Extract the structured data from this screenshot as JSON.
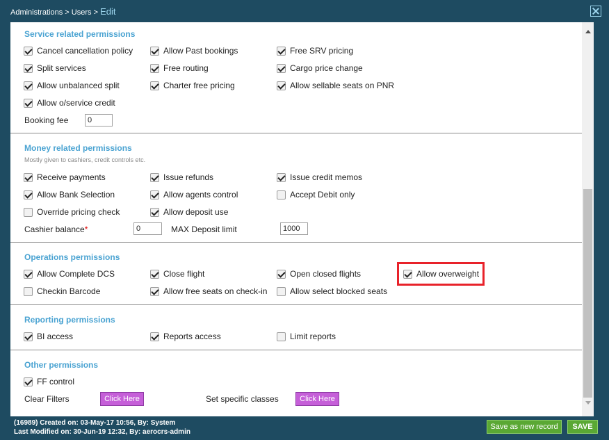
{
  "breadcrumb": {
    "part1": "Administrations",
    "sep": ">",
    "part2": "Users",
    "current": "Edit"
  },
  "service": {
    "title": "Service related permissions",
    "checkboxes": [
      {
        "label": "Cancel cancellation policy",
        "checked": true
      },
      {
        "label": "Allow Past bookings",
        "checked": true
      },
      {
        "label": "Free SRV pricing",
        "checked": true
      },
      {
        "label": "Split services",
        "checked": true
      },
      {
        "label": "Free routing",
        "checked": true
      },
      {
        "label": "Cargo price change",
        "checked": true
      },
      {
        "label": "Allow unbalanced split",
        "checked": true
      },
      {
        "label": "Charter free pricing",
        "checked": true
      },
      {
        "label": "Allow sellable seats on PNR",
        "checked": true
      },
      {
        "label": "Allow o/service credit",
        "checked": true
      }
    ],
    "booking_fee_label": "Booking fee",
    "booking_fee_value": "0"
  },
  "money": {
    "title": "Money related permissions",
    "subtitle": "Mostly given to cashiers, credit controls etc.",
    "checkboxes": [
      {
        "label": "Receive payments",
        "checked": true
      },
      {
        "label": "Issue refunds",
        "checked": true
      },
      {
        "label": "Issue credit memos",
        "checked": true
      },
      {
        "label": "Allow Bank Selection",
        "checked": true
      },
      {
        "label": "Allow agents control",
        "checked": true
      },
      {
        "label": "Accept Debit only",
        "checked": false
      },
      {
        "label": "Override pricing check",
        "checked": false
      },
      {
        "label": "Allow deposit use",
        "checked": true
      }
    ],
    "cashier_balance_label": "Cashier balance",
    "required_mark": "*",
    "cashier_balance_value": "0",
    "max_deposit_label": "MAX Deposit limit",
    "max_deposit_value": "1000"
  },
  "operations": {
    "title": "Operations permissions",
    "checkboxes": [
      {
        "label": "Allow Complete DCS",
        "checked": true
      },
      {
        "label": "Close flight",
        "checked": true
      },
      {
        "label": "Open closed flights",
        "checked": true
      },
      {
        "label": "Allow overweight",
        "checked": true
      },
      {
        "label": "Checkin Barcode",
        "checked": false
      },
      {
        "label": "Allow free seats on check-in",
        "checked": true
      },
      {
        "label": "Allow select blocked seats",
        "checked": false
      }
    ],
    "highlight_color": "#e8222a"
  },
  "reporting": {
    "title": "Reporting permissions",
    "checkboxes": [
      {
        "label": "BI access",
        "checked": true
      },
      {
        "label": "Reports access",
        "checked": true
      },
      {
        "label": "Limit reports",
        "checked": false
      }
    ]
  },
  "other": {
    "title": "Other permissions",
    "checkboxes": [
      {
        "label": "FF control",
        "checked": true
      }
    ],
    "clear_filters_label": "Clear Filters",
    "click_here": "Click Here",
    "set_classes_label": "Set specific classes"
  },
  "footer": {
    "created": "(16989) Created on: 03-May-17 10:56, By: System",
    "modified": "Last Modified on: 30-Jun-19 12:32, By: aerocrs-admin",
    "save_new_label": "Save as new record",
    "save_label": "SAVE"
  },
  "colors": {
    "background": "#1e4b61",
    "section_title": "#4aa3d2",
    "click_button": "#c55fd8",
    "save_button": "#5aa834"
  }
}
